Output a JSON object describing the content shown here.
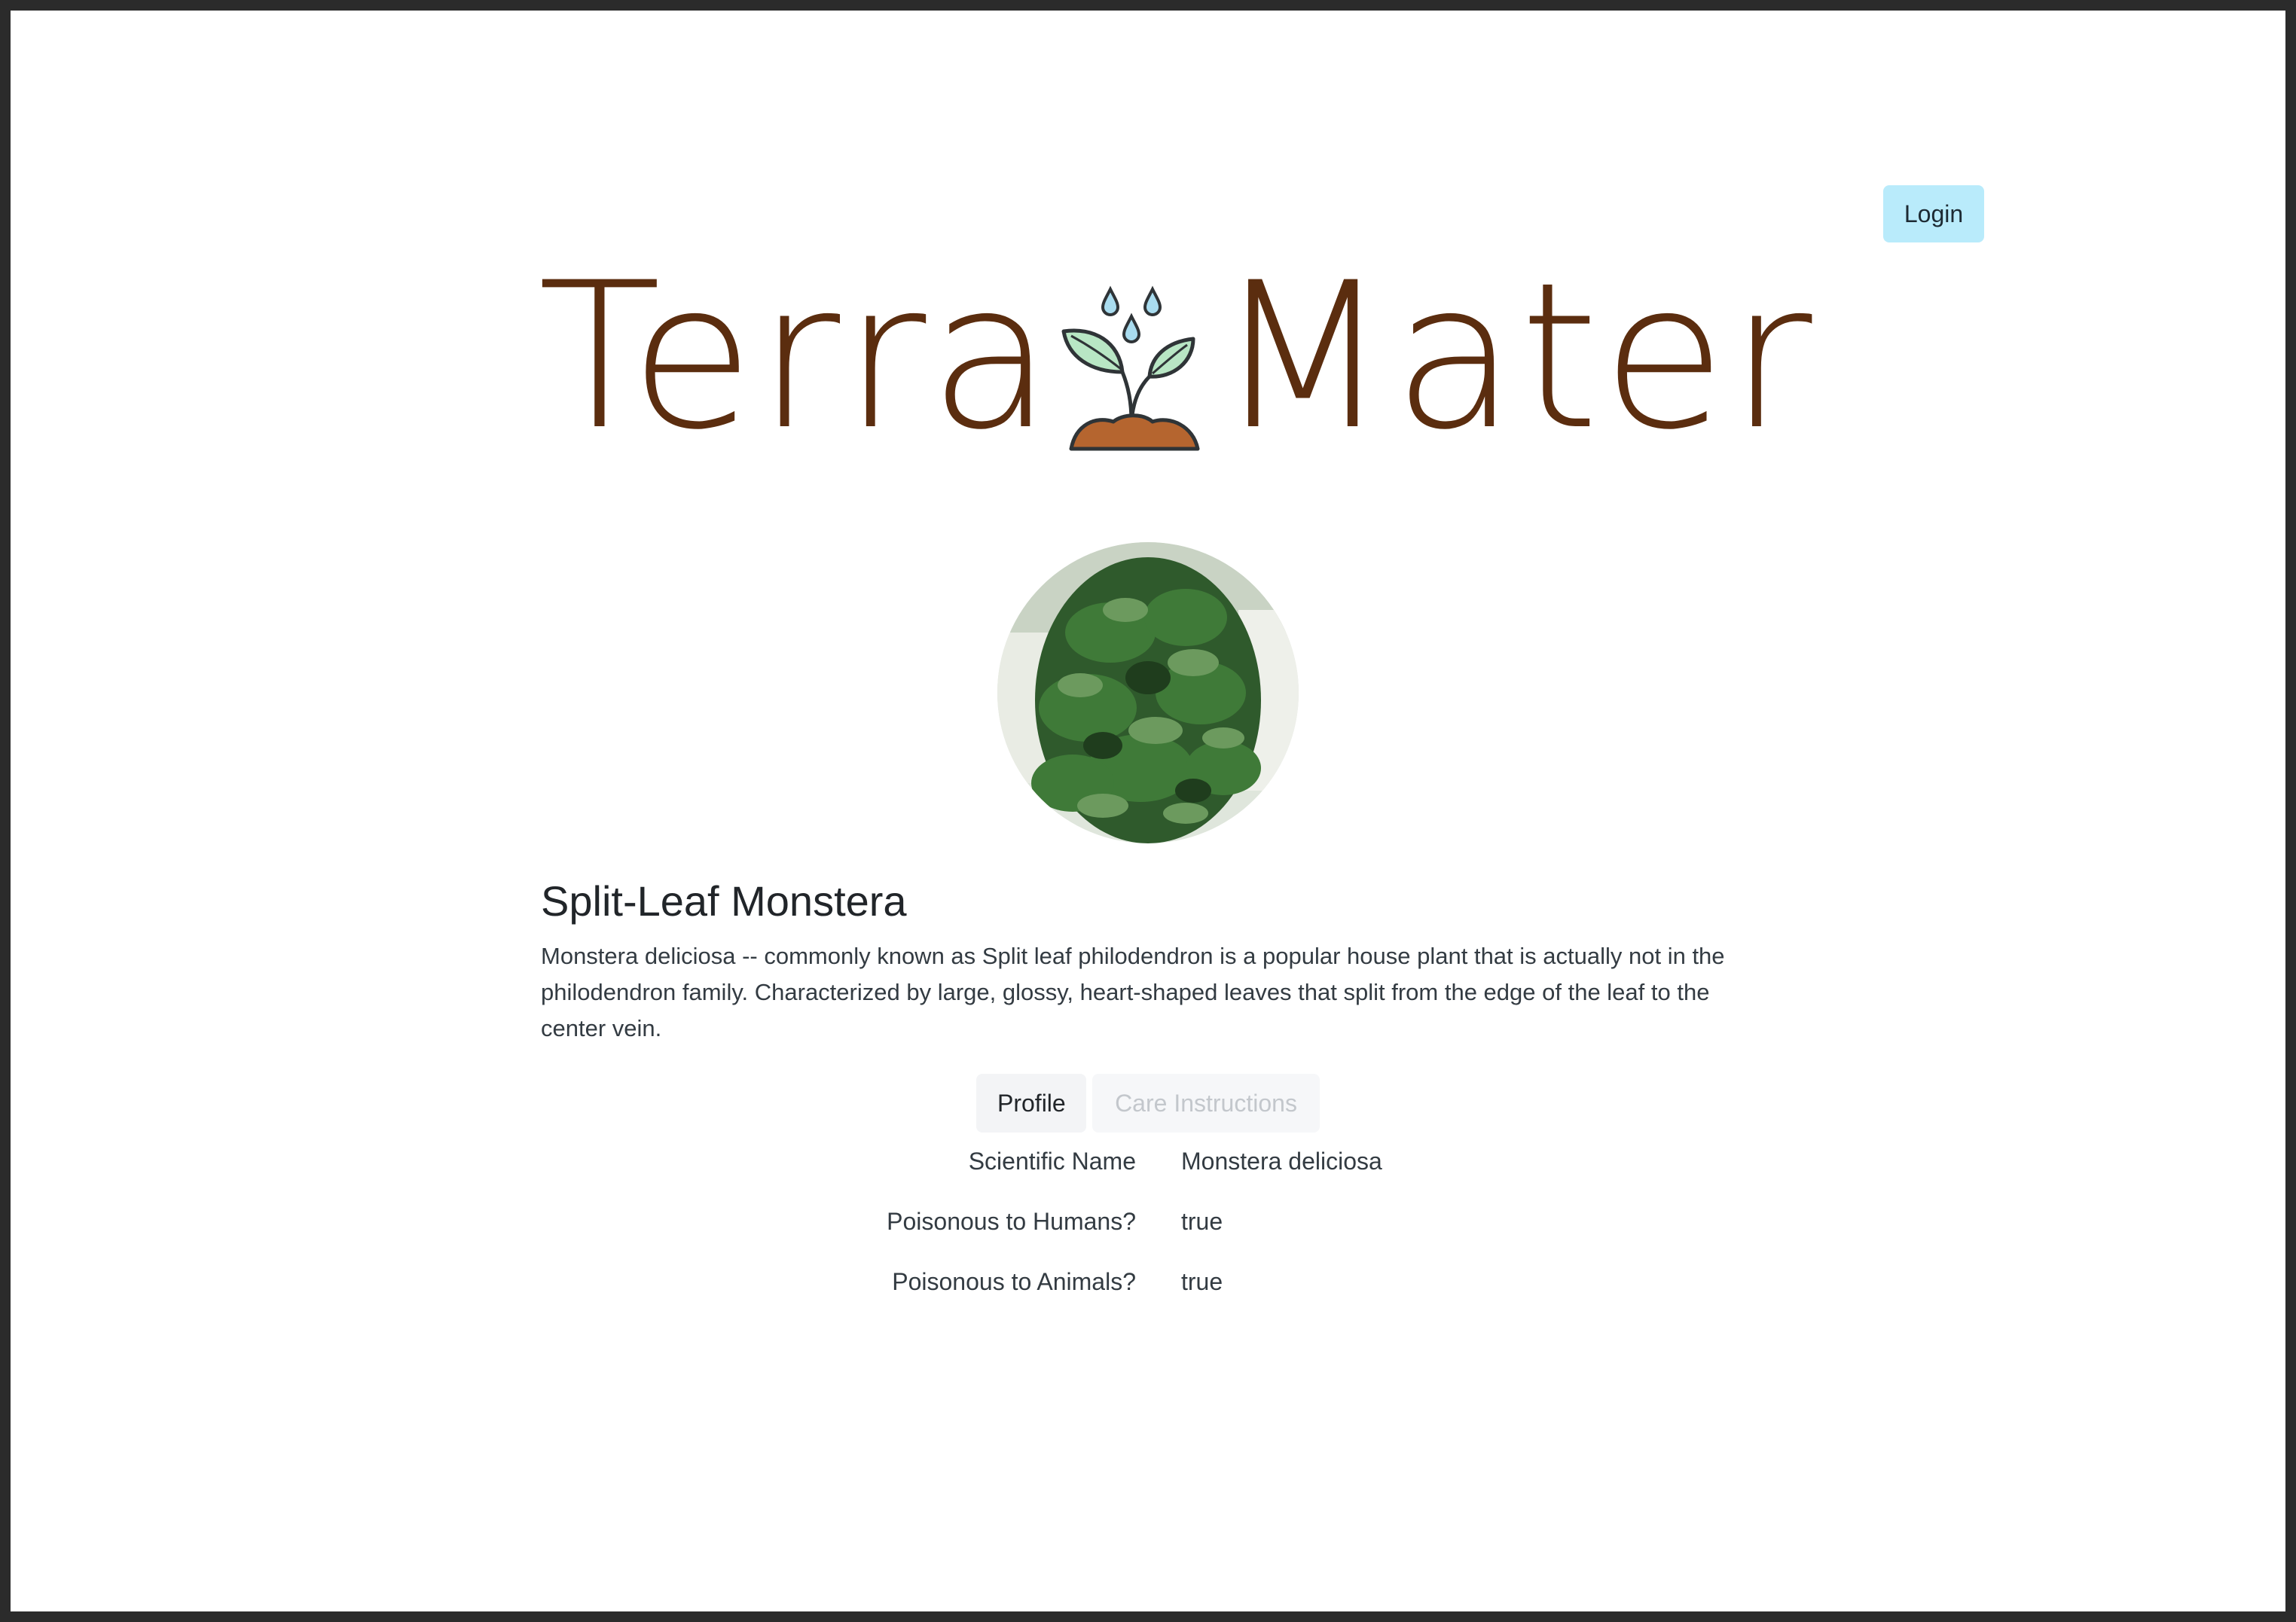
{
  "header": {
    "login_label": "Login",
    "logo": {
      "word_left": "Terra",
      "word_right": "Mater",
      "icon": "sprout-with-water-drops-icon",
      "text_color": "#5b2d0f"
    }
  },
  "plant": {
    "image": "monstera-photo",
    "name": "Split-Leaf Monstera",
    "description": "Monstera deliciosa -- commonly known as Split leaf philodendron is a popular house plant that is actually not in the philodendron family. Characterized by large, glossy, heart-shaped leaves that split from the edge of the leaf to the center vein."
  },
  "tabs": [
    {
      "label": "Profile",
      "active": true
    },
    {
      "label": "Care Instructions",
      "active": false
    }
  ],
  "profile": [
    {
      "label": "Scientific Name",
      "value": "Monstera deliciosa"
    },
    {
      "label": "Poisonous to Humans?",
      "value": "true"
    },
    {
      "label": "Poisonous to Animals?",
      "value": "true"
    }
  ],
  "colors": {
    "login_bg": "#b9ebfb",
    "leaf": "#b8e6c4",
    "soil": "#b5652f",
    "drop": "#a9dcef"
  }
}
